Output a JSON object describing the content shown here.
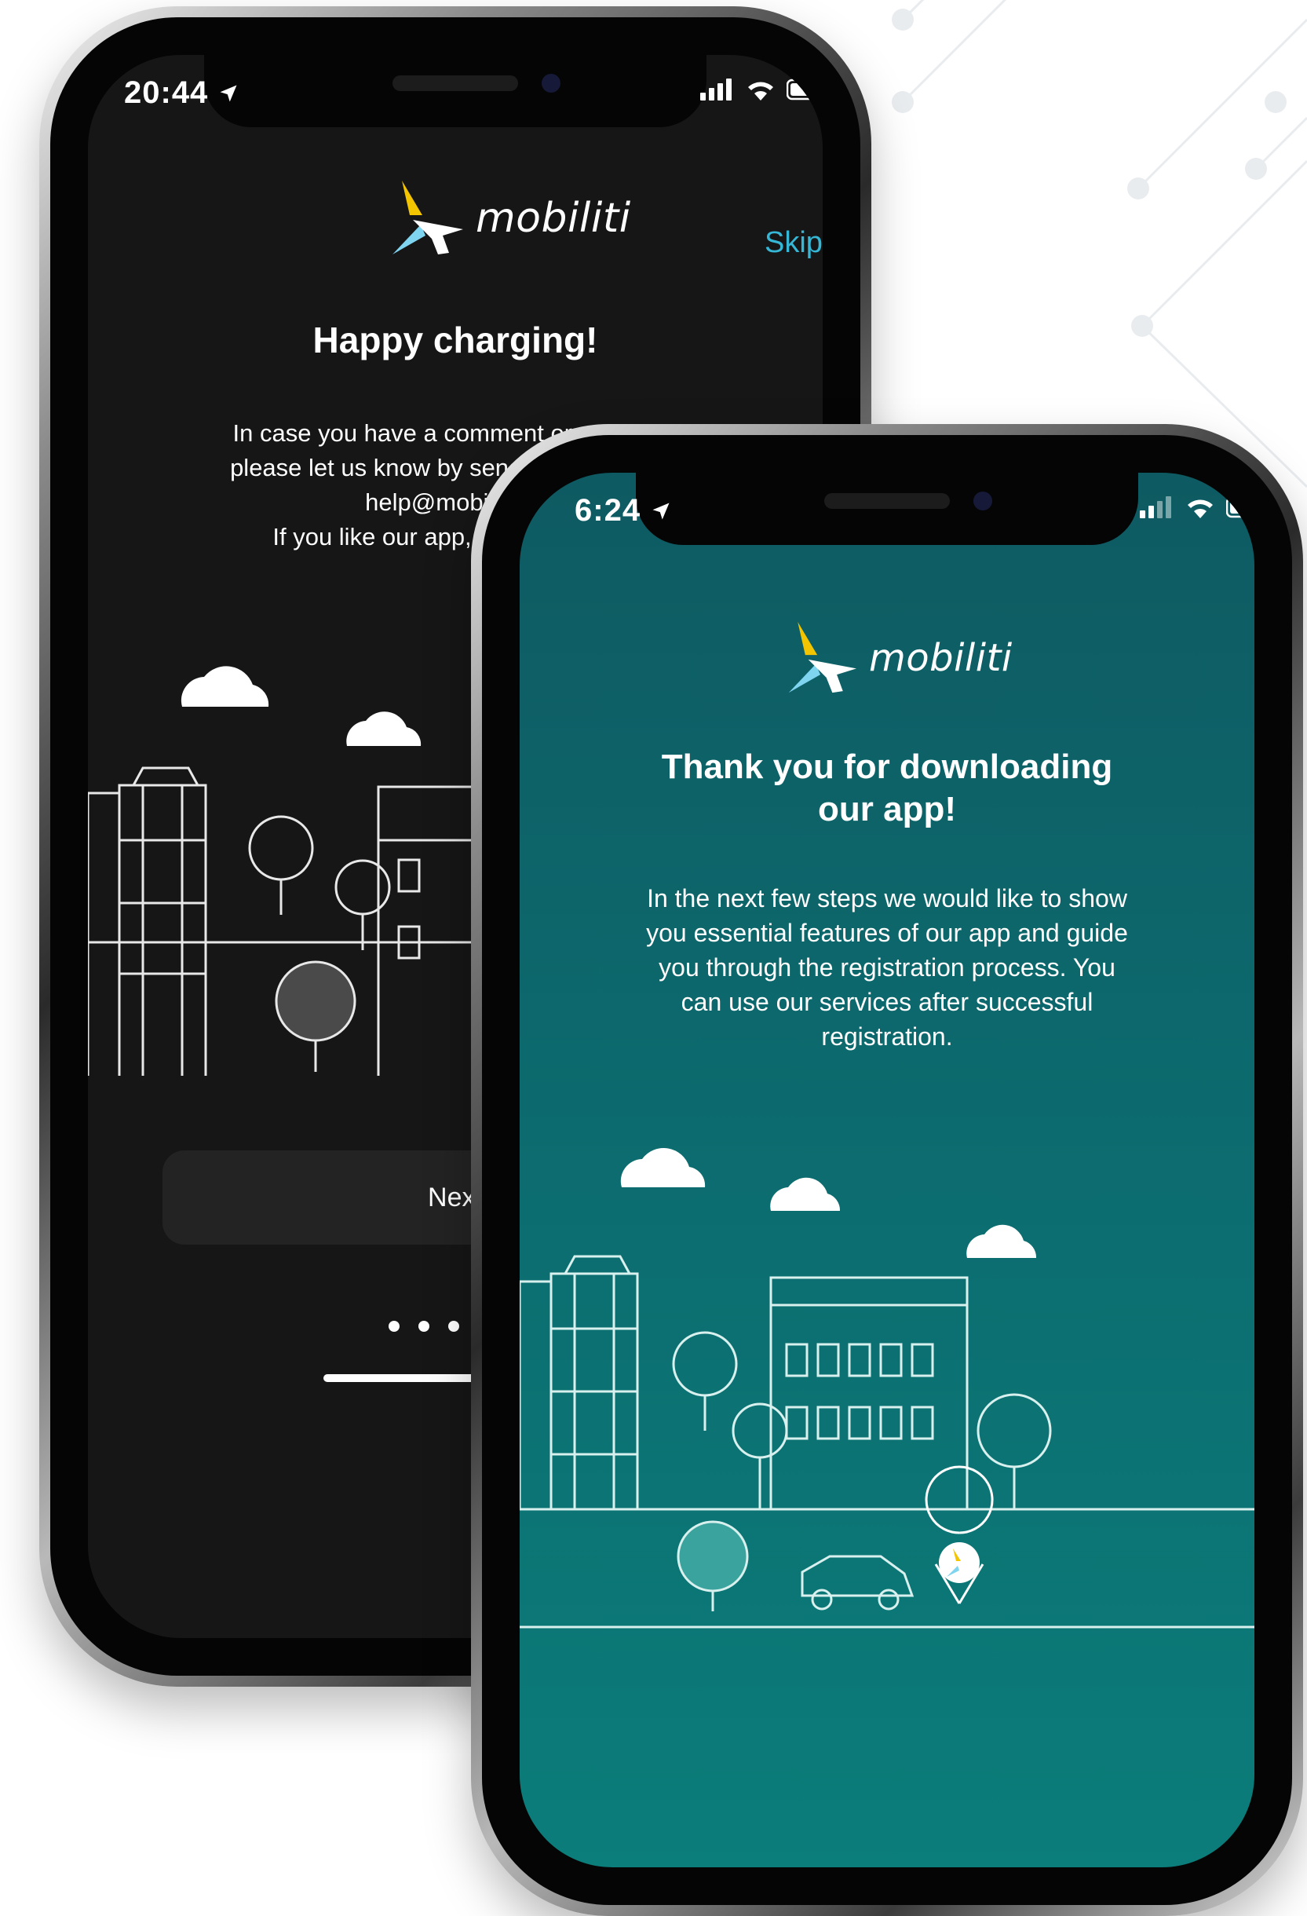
{
  "back_phone": {
    "status": {
      "time": "20:44"
    },
    "skip_label": "Skip",
    "brand": "mobiliti",
    "title": "Happy charging!",
    "body_lines": [
      "In case you have a comment or question,",
      "please let us know by sending an email to",
      "help@mobiliti.hu",
      "If you like our app, please rate us."
    ],
    "next_label": "Next",
    "page_dots": 5,
    "colors": {
      "background": "#161616",
      "accent": "#36b7d6",
      "button": "#232323"
    }
  },
  "front_phone": {
    "status": {
      "time": "6:24"
    },
    "brand": "mobiliti",
    "title_lines": [
      "Thank you for downloading",
      "our app!"
    ],
    "body_lines": [
      "In the next few steps we would like to show",
      "you essential features of our app and guide",
      "you through the registration process. You",
      "can use our services after successful",
      "registration."
    ],
    "colors": {
      "background_top": "#0e5a62",
      "background_bottom": "#0b7d7a"
    }
  },
  "icons": [
    "location-arrow-icon",
    "signal-icon",
    "wifi-icon",
    "battery-icon",
    "mobiliti-logo-icon",
    "cloud-icon",
    "tree-icon",
    "car-icon",
    "map-pin-icon"
  ]
}
